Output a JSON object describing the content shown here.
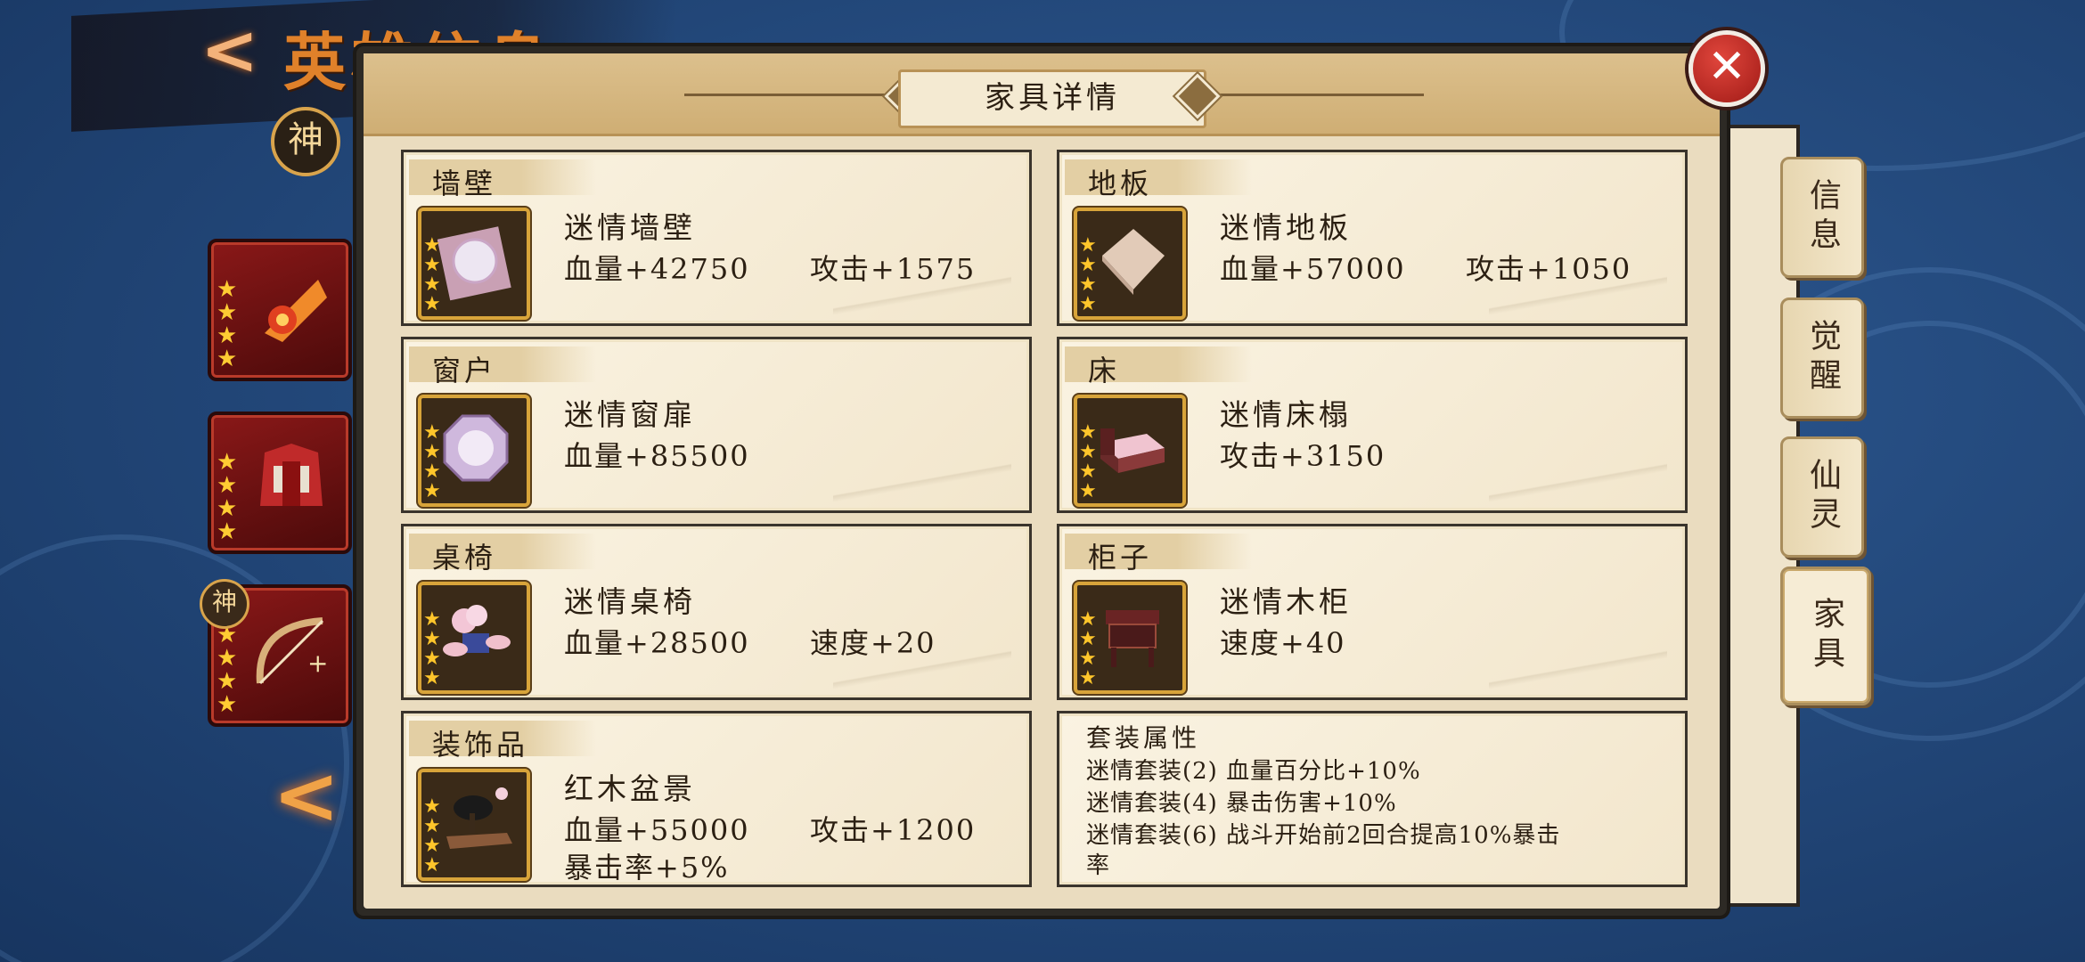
{
  "background": {
    "hero_title": "英雄信息",
    "god_badge": "神",
    "side_god_badge": "神"
  },
  "modal": {
    "title": "家具详情",
    "close_label": "✕"
  },
  "furniture": [
    {
      "category": "墙壁",
      "name": "迷情墙壁",
      "stats": [
        "血量+42750",
        "攻击+1575"
      ],
      "icon": "wallpaper-icon",
      "stars": 4
    },
    {
      "category": "地板",
      "name": "迷情地板",
      "stats": [
        "血量+57000",
        "攻击+1050"
      ],
      "icon": "floor-icon",
      "stars": 4
    },
    {
      "category": "窗户",
      "name": "迷情窗扉",
      "stats": [
        "血量+85500"
      ],
      "icon": "window-icon",
      "stars": 4
    },
    {
      "category": "床",
      "name": "迷情床榻",
      "stats": [
        "攻击+3150"
      ],
      "icon": "bed-icon",
      "stars": 4
    },
    {
      "category": "桌椅",
      "name": "迷情桌椅",
      "stats": [
        "血量+28500",
        "速度+20"
      ],
      "icon": "table-chairs-icon",
      "stars": 4
    },
    {
      "category": "柜子",
      "name": "迷情木柜",
      "stats": [
        "速度+40"
      ],
      "icon": "cabinet-icon",
      "stars": 4
    },
    {
      "category": "装饰品",
      "name": "红木盆景",
      "stats": [
        "血量+55000",
        "攻击+1200",
        "暴击率+5%"
      ],
      "icon": "bonsai-icon",
      "stars": 4
    }
  ],
  "set_bonus": {
    "title": "套装属性",
    "lines": [
      "迷情套装(2) 血量百分比+10%",
      "迷情套装(4) 暴击伤害+10%",
      "迷情套装(6) 战斗开始前2回合提高10%暴击",
      "率"
    ]
  },
  "tabs": [
    {
      "label": "信息",
      "active": false
    },
    {
      "label": "觉醒",
      "active": false
    },
    {
      "label": "仙灵",
      "active": false
    },
    {
      "label": "家具",
      "active": true
    }
  ],
  "colors": {
    "accent_gold": "#d8a43a",
    "close_red": "#c0281f",
    "paper": "#eadcbf"
  }
}
